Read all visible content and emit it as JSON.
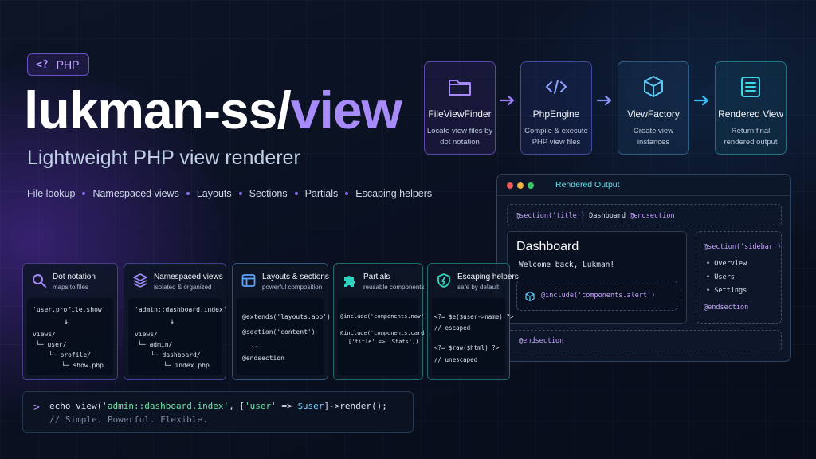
{
  "badge": {
    "icon": "php-tag-icon",
    "tag": "<?",
    "label": "PHP"
  },
  "title": {
    "main": "lukman-ss/",
    "accent": "view"
  },
  "subtitle": "Lightweight PHP view renderer",
  "features": [
    "File lookup",
    "Namespaced views",
    "Layouts",
    "Sections",
    "Partials",
    "Escaping helpers"
  ],
  "pipeline": [
    {
      "name": "FileViewFinder",
      "desc": "Locate view files by dot notation",
      "icon": "folder-icon",
      "color": "#8b6cf2"
    },
    {
      "name": "PhpEngine",
      "desc": "Compile & execute PHP view files",
      "icon": "code-icon",
      "color": "#6f7ff0"
    },
    {
      "name": "ViewFactory",
      "desc": "Create view instances",
      "icon": "cube-icon",
      "color": "#38bdf8"
    },
    {
      "name": "Rendered View",
      "desc": "Return final rendered output",
      "icon": "document-icon",
      "color": "#22d3ee"
    }
  ],
  "output": {
    "title": "Rendered Output",
    "section_title_pre": "@section('title')",
    "section_title_mid": " Dashboard ",
    "section_title_post": "@endsection",
    "heading": "Dashboard",
    "welcome": "Welcome back, Lukman!",
    "include_line": "@include('components.alert')",
    "sidebar_open": "@section('sidebar')",
    "sidebar_items": [
      "Overview",
      "Users",
      "Settings"
    ],
    "sidebar_close": "@endsection",
    "footer_close": "@endsection"
  },
  "cards": [
    {
      "title": "Dot notation",
      "sub": "maps to files",
      "icon": "search-icon",
      "color": "#8b6cf2",
      "lines": [
        "'user.profile.show'",
        "↓",
        "views/",
        "└─ user/",
        "└─ profile/",
        "└─ show.php"
      ]
    },
    {
      "title": "Namespaced views",
      "sub": "isolated & organized",
      "icon": "layers-icon",
      "color": "#7c6cf0",
      "lines": [
        "'admin::dashboard.index'",
        "↓",
        "views/",
        "└─ admin/",
        "└─ dashboard/",
        "└─ index.php"
      ]
    },
    {
      "title": "Layouts & sections",
      "sub": "powerful composition",
      "icon": "layout-icon",
      "color": "#60a5fa",
      "lines": [
        "@extends('layouts.app')",
        "@section('content')",
        "...",
        "@endsection"
      ]
    },
    {
      "title": "Partials",
      "sub": "reusable components",
      "icon": "puzzle-icon",
      "color": "#2dd4bf",
      "lines": [
        "@include('components.nav')",
        "@include('components.card',",
        "['title' => 'Stats'])"
      ]
    },
    {
      "title": "Escaping helpers",
      "sub": "safe by default",
      "icon": "shield-icon",
      "color": "#2dd4bf",
      "lines": [
        "<?= $e($user->name) ?>",
        "// escaped",
        "<?= $raw($html) ?>",
        "// unescaped"
      ]
    }
  ],
  "terminal": {
    "prompt": ">",
    "code_pre": "echo view(",
    "code_str1": "'admin::dashboard.index'",
    "code_mid": ", [",
    "code_str2": "'user'",
    "code_arrow": " => ",
    "code_var": "$user",
    "code_post": "]->render();",
    "comment": "// Simple. Powerful. Flexible."
  }
}
